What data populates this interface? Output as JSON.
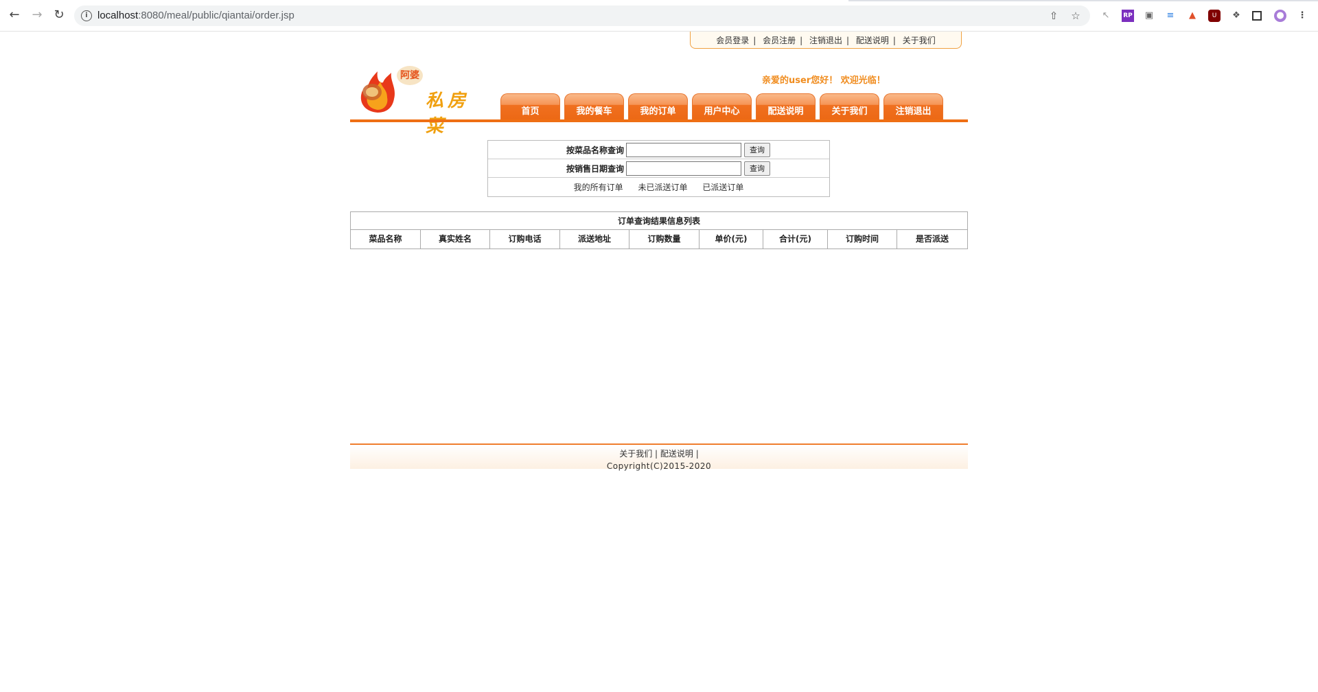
{
  "browser": {
    "url_host": "localhost",
    "url_path": ":8080/meal/public/qiantai/order.jsp"
  },
  "toplinks": [
    "会员登录",
    "会员注册",
    "注销退出",
    "配送说明",
    "关于我们"
  ],
  "separator": "|",
  "logo": {
    "badge": "阿婆",
    "calligraphy": "私房菜"
  },
  "welcome": "亲爱的user您好！ 欢迎光临！",
  "nav": [
    "首页",
    "我的餐车",
    "我的订单",
    "用户中心",
    "配送说明",
    "关于我们",
    "注销退出"
  ],
  "search": {
    "by_name_label": "按菜品名称查询",
    "by_date_label": "按销售日期查询",
    "query_button": "查询",
    "filters": [
      "我的所有订单",
      "未已派送订单",
      "已派送订单"
    ]
  },
  "results": {
    "caption": "订单查询结果信息列表",
    "columns": [
      "菜品名称",
      "真实姓名",
      "订购电话",
      "派送地址",
      "订购数量",
      "单价(元)",
      "合计(元)",
      "订购时间",
      "是否派送"
    ]
  },
  "footer": {
    "links": [
      "关于我们",
      "配送说明"
    ],
    "copyright": "Copyright(C)2015-2020"
  }
}
